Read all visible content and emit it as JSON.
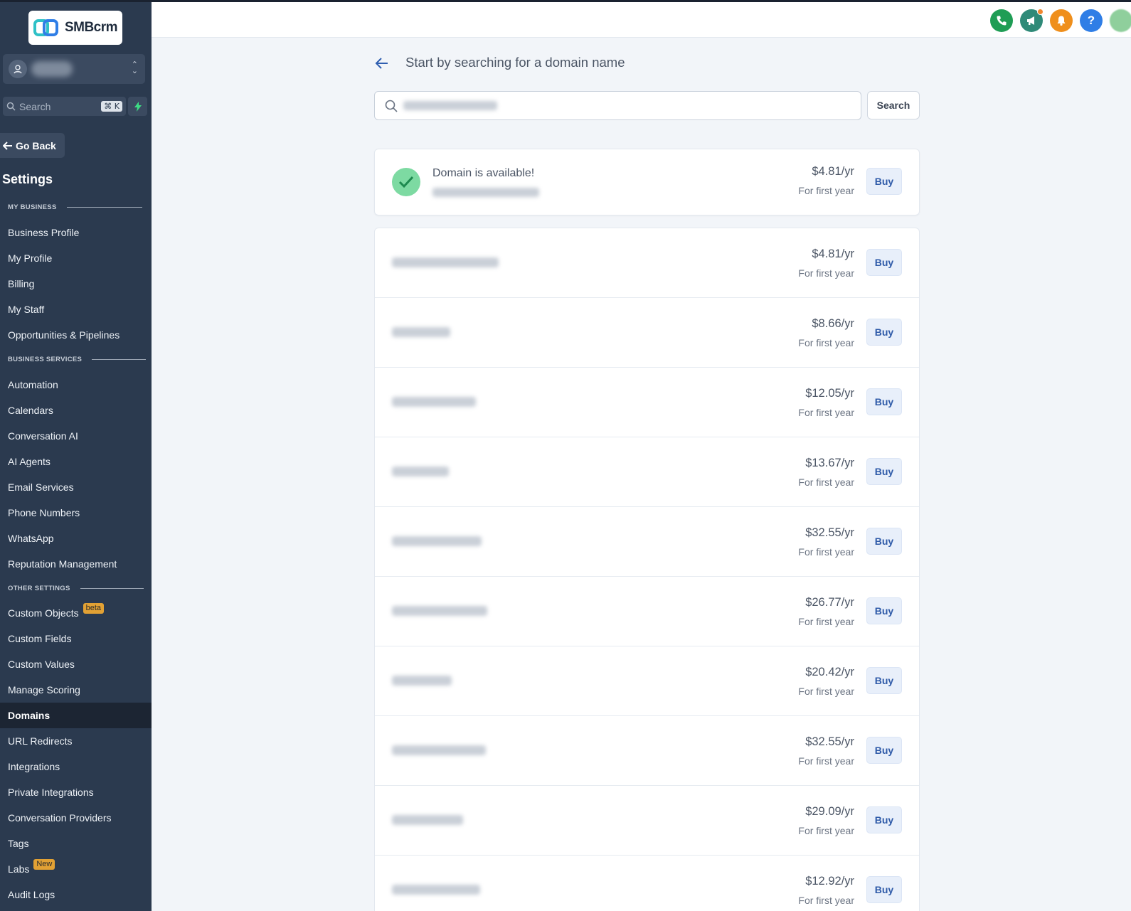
{
  "sidebar": {
    "logo_text": "SMBcrm",
    "search_placeholder": "Search",
    "search_shortcut": "⌘ K",
    "go_back": "Go Back",
    "settings_title": "Settings",
    "sections": {
      "my_business": "MY BUSINESS",
      "business_services": "BUSINESS SERVICES",
      "other_settings": "OTHER SETTINGS"
    },
    "items": [
      {
        "label": "Business Profile"
      },
      {
        "label": "My Profile"
      },
      {
        "label": "Billing"
      },
      {
        "label": "My Staff"
      },
      {
        "label": "Opportunities & Pipelines"
      },
      {
        "label": "Automation"
      },
      {
        "label": "Calendars"
      },
      {
        "label": "Conversation AI"
      },
      {
        "label": "AI Agents"
      },
      {
        "label": "Email Services"
      },
      {
        "label": "Phone Numbers"
      },
      {
        "label": "WhatsApp"
      },
      {
        "label": "Reputation Management"
      },
      {
        "label": "Custom Objects",
        "badge": "beta"
      },
      {
        "label": "Custom Fields"
      },
      {
        "label": "Custom Values"
      },
      {
        "label": "Manage Scoring"
      },
      {
        "label": "Domains",
        "active": true
      },
      {
        "label": "URL Redirects"
      },
      {
        "label": "Integrations"
      },
      {
        "label": "Private Integrations"
      },
      {
        "label": "Conversation Providers"
      },
      {
        "label": "Tags"
      },
      {
        "label": "Labs",
        "badge": "New"
      },
      {
        "label": "Audit Logs"
      }
    ]
  },
  "header": {
    "icons": [
      "phone-icon",
      "megaphone-icon",
      "bell-icon",
      "help-icon",
      "avatar"
    ],
    "colors": {
      "phone": "#1f9d55",
      "megaphone": "#2f8a78",
      "bell": "#ef8f1c",
      "help": "#2f7ee6"
    }
  },
  "main": {
    "heading": "Start by searching for a domain name",
    "search_button": "Search",
    "available": {
      "title": "Domain is available!",
      "price": "$4.81/yr",
      "price_note": "For first year",
      "buy": "Buy"
    },
    "results": [
      {
        "price": "$4.81/yr",
        "note": "For first year",
        "buy": "Buy"
      },
      {
        "price": "$8.66/yr",
        "note": "For first year",
        "buy": "Buy"
      },
      {
        "price": "$12.05/yr",
        "note": "For first year",
        "buy": "Buy"
      },
      {
        "price": "$13.67/yr",
        "note": "For first year",
        "buy": "Buy"
      },
      {
        "price": "$32.55/yr",
        "note": "For first year",
        "buy": "Buy"
      },
      {
        "price": "$26.77/yr",
        "note": "For first year",
        "buy": "Buy"
      },
      {
        "price": "$20.42/yr",
        "note": "For first year",
        "buy": "Buy"
      },
      {
        "price": "$32.55/yr",
        "note": "For first year",
        "buy": "Buy"
      },
      {
        "price": "$29.09/yr",
        "note": "For first year",
        "buy": "Buy"
      },
      {
        "price": "$12.92/yr",
        "note": "For first year",
        "buy": "Buy"
      }
    ]
  }
}
